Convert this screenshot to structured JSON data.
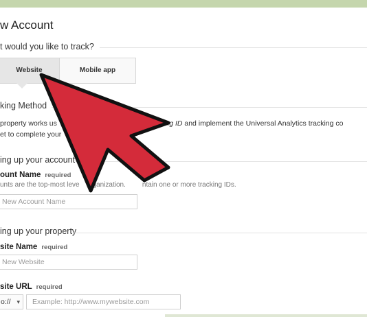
{
  "page": {
    "title": "w Account",
    "track_question": "t would you like to track?"
  },
  "tabs": {
    "website_label": "Website",
    "mobile_label": "Mobile app"
  },
  "tracking": {
    "heading": "king Method",
    "line1_prefix": "property works us",
    "line1_italic": "et Tracking ID",
    "line1_suffix": " and implement the Universal Analytics tracking co",
    "line2": "et to complete your"
  },
  "account_section": {
    "heading": "ing up your account",
    "name_label": "ount Name",
    "required": "required",
    "description_prefix": "unts are the top-most leve",
    "description_suffix": "ntain one or more tracking IDs.",
    "description_mid": "organization.",
    "input_placeholder": "New Account Name"
  },
  "property_section": {
    "heading": "ing up your property",
    "website_name_label": "site Name",
    "required": "required",
    "website_name_placeholder": "New Website",
    "website_url_label": "site URL",
    "url_required": "required",
    "protocol_value": "o://",
    "protocol_caret": "▾",
    "url_placeholder": "Example: http://www.mywebsite.com"
  },
  "colors": {
    "arrow_fill": "#d42b3a",
    "arrow_stroke": "#111111",
    "top_bar": "#c5d6ad"
  },
  "icons": {
    "overlay": "large-red-pointer-arrow-icon"
  }
}
